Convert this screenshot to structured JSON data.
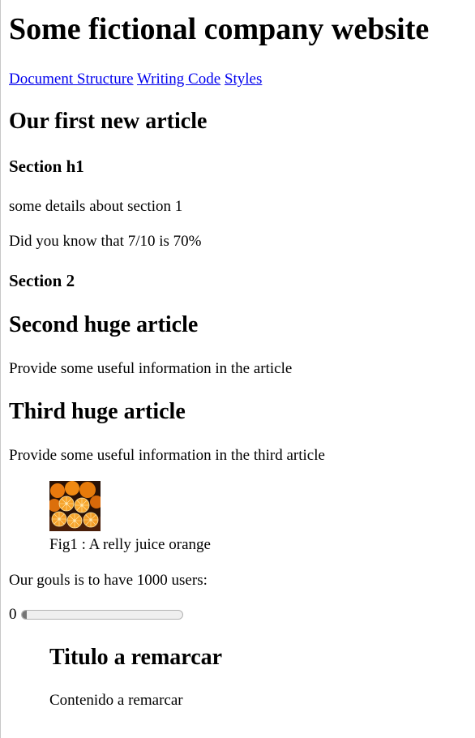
{
  "header": {
    "title": "Some fictional company website",
    "nav": [
      "Document Structure",
      "Writing Code",
      "Styles"
    ]
  },
  "article1": {
    "title": "Our first new article",
    "section1": {
      "title": "Section h1",
      "p1": "some details about section 1",
      "p2": "Did you know that 7/10 is 70%"
    },
    "section2": {
      "title": "Section 2"
    }
  },
  "article2": {
    "title": "Second huge article",
    "p": "Provide some useful information in the article"
  },
  "article3": {
    "title": "Third huge article",
    "p": "Provide some useful information in the third article"
  },
  "figure": {
    "image": "orange-image",
    "caption": "Fig1 : A relly juice orange"
  },
  "goal": {
    "text": "Our gouls is to have 1000 users:",
    "value_label": "0",
    "progress_fraction": 0.03
  },
  "aside": {
    "title": "Titulo a remarcar",
    "content": "Contenido a remarcar"
  },
  "colors": {
    "link": "#0000ee",
    "progress_fill": "#757575",
    "progress_track": "#efefef"
  }
}
